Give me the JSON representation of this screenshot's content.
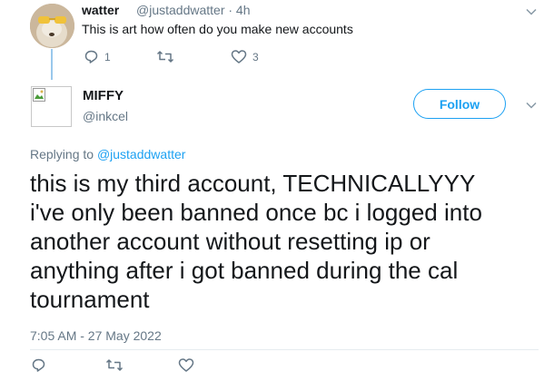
{
  "parent_tweet": {
    "name": "watter",
    "handle_time": "@justaddwatter · 4h",
    "text": "This is art how often do you make new accounts",
    "reply_count": "1",
    "like_count": "3"
  },
  "main_tweet": {
    "name": "MIFFY",
    "handle": "@inkcel",
    "follow_label": "Follow",
    "replying_prefix": "Replying to ",
    "replying_handle": "@justaddwatter",
    "text_lines": [
      "this is my third account, TECHNICALLYYY",
      "i've only been banned once bc i logged into",
      "another account without resetting ip or",
      "anything after i got banned during the cal",
      "tournament"
    ],
    "timestamp": "7:05 AM - 27 May 2022"
  },
  "colors": {
    "accent": "#1da1f2",
    "secondary_text": "#657786",
    "thread_line": "#9ac8ec"
  },
  "icons": {
    "reply": "reply-icon",
    "retweet": "retweet-icon",
    "like": "heart-icon",
    "caret": "chevron-down-icon"
  }
}
